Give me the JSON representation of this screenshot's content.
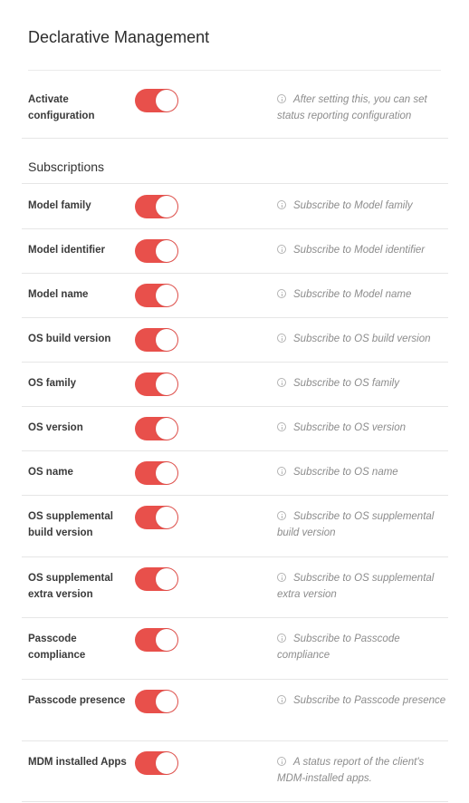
{
  "title": "Declarative Management",
  "activate": {
    "label": "Activate configuration",
    "hint": "After setting this, you can set status reporting configuration"
  },
  "subscriptions_heading": "Subscriptions",
  "subscriptions": [
    {
      "label": "Model family",
      "hint": "Subscribe to Model family",
      "enabled": true
    },
    {
      "label": "Model identifier",
      "hint": "Subscribe to Model identifier",
      "enabled": true
    },
    {
      "label": "Model name",
      "hint": "Subscribe to Model name",
      "enabled": true
    },
    {
      "label": "OS build version",
      "hint": "Subscribe to OS build version",
      "enabled": true
    },
    {
      "label": "OS family",
      "hint": "Subscribe to OS family",
      "enabled": true
    },
    {
      "label": "OS version",
      "hint": "Subscribe to OS version",
      "enabled": true
    },
    {
      "label": "OS name",
      "hint": "Subscribe to OS name",
      "enabled": true
    },
    {
      "label": "OS supplemental build version",
      "hint": "Subscribe to OS supplemental build version",
      "enabled": true
    },
    {
      "label": "OS supplemental extra version",
      "hint": "Subscribe to OS supplemental extra version",
      "enabled": true
    },
    {
      "label": "Passcode compliance",
      "hint": "Subscribe to Passcode compliance",
      "enabled": true
    },
    {
      "label": "Passcode presence",
      "hint": "Subscribe to Passcode presence",
      "enabled": true
    },
    {
      "label": "MDM installed Apps",
      "hint": "A status report of the client's MDM-installed apps.",
      "enabled": true
    }
  ],
  "colors": {
    "toggle_on": "#e8504b",
    "hint_text": "#8c8c8c"
  }
}
